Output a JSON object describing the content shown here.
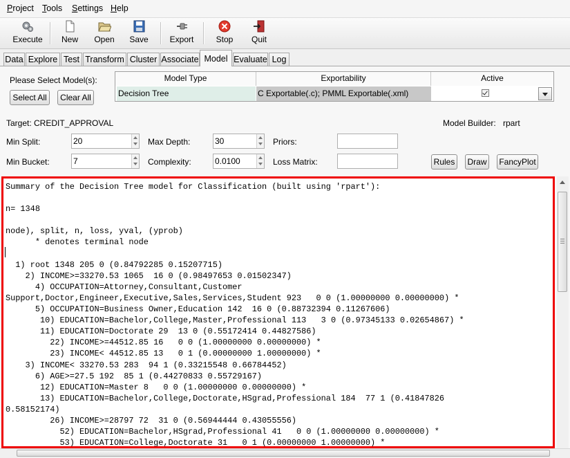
{
  "menu": {
    "items": [
      "Project",
      "Tools",
      "Settings",
      "Help"
    ]
  },
  "toolbar": {
    "execute": "Execute",
    "new": "New",
    "open": "Open",
    "save": "Save",
    "export": "Export",
    "stop": "Stop",
    "quit": "Quit"
  },
  "tabs": [
    "Data",
    "Explore",
    "Test",
    "Transform",
    "Cluster",
    "Associate",
    "Model",
    "Evaluate",
    "Log"
  ],
  "active_tab": "Model",
  "model_select": {
    "prompt": "Please Select Model(s):",
    "select_all": "Select All",
    "clear_all": "Clear All",
    "columns": [
      "Model Type",
      "Exportability",
      "Active"
    ],
    "row": {
      "model_type": "Decision Tree",
      "exportability": "C Exportable(.c); PMML Exportable(.xml)",
      "active": true
    }
  },
  "target": "Target: CREDIT_APPROVAL",
  "model_builder_label": "Model Builder:",
  "model_builder_value": "rpart",
  "params": {
    "min_split_label": "Min Split:",
    "min_split": "20",
    "max_depth_label": "Max Depth:",
    "max_depth": "30",
    "priors_label": "Priors:",
    "priors": "",
    "min_bucket_label": "Min Bucket:",
    "min_bucket": "7",
    "complexity_label": "Complexity:",
    "complexity": "0.0100",
    "loss_matrix_label": "Loss Matrix:",
    "loss_matrix": ""
  },
  "buttons": {
    "rules": "Rules",
    "draw": "Draw",
    "fancyplot": "FancyPlot"
  },
  "output_text": "Summary of the Decision Tree model for Classification (built using 'rpart'):\n\nn= 1348\n\nnode), split, n, loss, yval, (yprob)\n      * denotes terminal node\n\n  1) root 1348 205 0 (0.84792285 0.15207715)\n    2) INCOME>=33270.53 1065  16 0 (0.98497653 0.01502347)\n      4) OCCUPATION=Attorney,Consultant,Customer\nSupport,Doctor,Engineer,Executive,Sales,Services,Student 923   0 0 (1.00000000 0.00000000) *\n      5) OCCUPATION=Business Owner,Education 142  16 0 (0.88732394 0.11267606)\n       10) EDUCATION=Bachelor,College,Master,Professional 113   3 0 (0.97345133 0.02654867) *\n       11) EDUCATION=Doctorate 29  13 0 (0.55172414 0.44827586)\n         22) INCOME>=44512.85 16   0 0 (1.00000000 0.00000000) *\n         23) INCOME< 44512.85 13   0 1 (0.00000000 1.00000000) *\n    3) INCOME< 33270.53 283  94 1 (0.33215548 0.66784452)\n      6) AGE>=27.5 192  85 1 (0.44270833 0.55729167)\n       12) EDUCATION=Master 8   0 0 (1.00000000 0.00000000) *\n       13) EDUCATION=Bachelor,College,Doctorate,HSgrad,Professional 184  77 1 (0.41847826\n0.58152174)\n         26) INCOME>=28797 72  31 0 (0.56944444 0.43055556)\n           52) EDUCATION=Bachelor,HSgrad,Professional 41   0 0 (1.00000000 0.00000000) *\n           53) EDUCATION=College,Doctorate 31   0 1 (0.00000000 1.00000000) *"
}
